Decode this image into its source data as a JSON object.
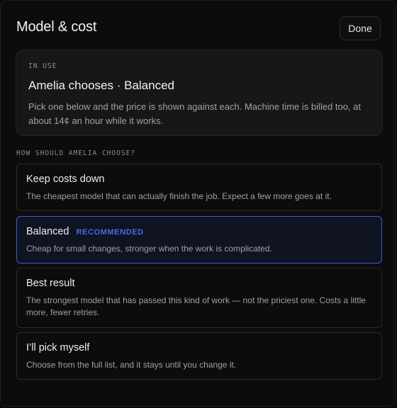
{
  "header": {
    "title": "Model & cost",
    "done_label": "Done"
  },
  "in_use": {
    "eyebrow": "IN USE",
    "title": "Amelia chooses · Balanced",
    "description": "Pick one below and the price is shown against each. Machine time is billed too, at about 14¢ an hour while it works."
  },
  "section": {
    "label": "HOW SHOULD AMELIA CHOOSE?"
  },
  "options": [
    {
      "title": "Keep costs down",
      "badge": "",
      "description": "The cheapest model that can actually finish the job. Expect a few more goes at it.",
      "selected": false
    },
    {
      "title": "Balanced",
      "badge": "RECOMMENDED",
      "description": "Cheap for small changes, stronger when the work is complicated.",
      "selected": true
    },
    {
      "title": "Best result",
      "badge": "",
      "description": "The strongest model that has passed this kind of work — not the priciest one. Costs a little more, fewer retries.",
      "selected": false
    },
    {
      "title": "I’ll pick myself",
      "badge": "",
      "description": "Choose from the full list, and it stays until you change it.",
      "selected": false
    }
  ],
  "colors": {
    "accent": "#4b68e6",
    "selected_border": "#3f5bd1",
    "background": "#0c0c0d"
  }
}
